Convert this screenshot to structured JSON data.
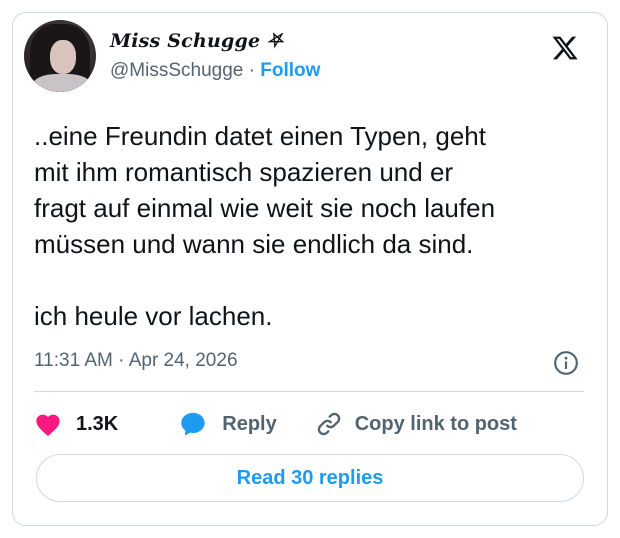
{
  "author": {
    "display_name": "Miss Schugge",
    "display_name_glyph": "⛧",
    "handle": "@MissSchugge",
    "separator": " · ",
    "follow_label": "Follow"
  },
  "brand": {
    "logo_icon": "x-logo-icon"
  },
  "tweet": {
    "text": "..eine Freundin datet einen Typen, geht\nmit ihm romantisch spazieren und er\nfragt auf einmal wie weit sie noch laufen\nmüssen und wann sie endlich da sind.\n\nich heule vor lachen.",
    "timestamp": "11:31 AM · Apr 24, 2026"
  },
  "actions": {
    "like_count": "1.3K",
    "reply_label": "Reply",
    "copy_label": "Copy link to post"
  },
  "read_replies_label": "Read 30 replies",
  "colors": {
    "accent": "#1d9bf0",
    "like": "#f91880",
    "text": "#0f1419",
    "secondary": "#536471",
    "border": "#cfd9de"
  }
}
